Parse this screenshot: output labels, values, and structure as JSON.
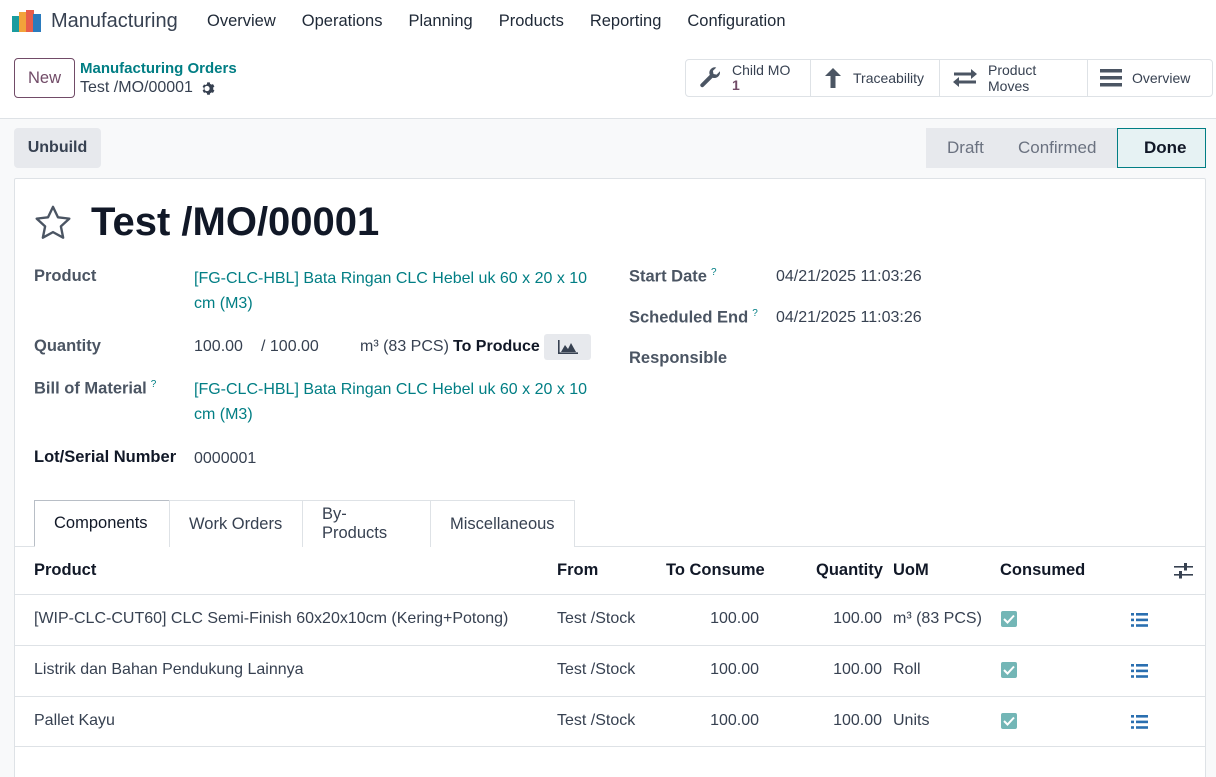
{
  "app": {
    "name": "Manufacturing"
  },
  "menu": [
    "Overview",
    "Operations",
    "Planning",
    "Products",
    "Reporting",
    "Configuration"
  ],
  "control": {
    "new_label": "New",
    "breadcrumb_parent": "Manufacturing Orders",
    "breadcrumb_current": "Test /MO/00001"
  },
  "smart_buttons": {
    "child_mo_label": "Child MO",
    "child_mo_count": "1",
    "traceability": "Traceability",
    "product_moves": "Product Moves",
    "overview": "Overview"
  },
  "actions": {
    "unbuild": "Unbuild"
  },
  "status": {
    "stages": [
      "Draft",
      "Confirmed",
      "Done"
    ],
    "current": "Done"
  },
  "form": {
    "title": "Test /MO/00001",
    "product_label": "Product",
    "product_line1": "[FG-CLC-HBL] Bata Ringan CLC Hebel uk 60 x 20 x 10",
    "product_line2": "cm (M3)",
    "quantity_label": "Quantity",
    "quantity_value": "100.00",
    "quantity_total": "/ 100.00",
    "quantity_uom": "m³ (83 PCS)",
    "to_produce": "To Produce",
    "bom_label": "Bill of Material",
    "bom_line1": "[FG-CLC-HBL] Bata Ringan CLC Hebel uk 60 x 20 x 10",
    "bom_line2": "cm (M3)",
    "lot_label": "Lot/Serial Number",
    "lot_value": "0000001",
    "start_label": "Start Date",
    "start_value": "04/21/2025 11:03:26",
    "end_label": "Scheduled End",
    "end_value": "04/21/2025 11:03:26",
    "responsible_label": "Responsible",
    "help_mark": "?"
  },
  "tabs": [
    "Components",
    "Work Orders",
    "By-Products",
    "Miscellaneous"
  ],
  "table": {
    "headers": {
      "product": "Product",
      "from": "From",
      "to_consume": "To Consume",
      "quantity": "Quantity",
      "uom": "UoM",
      "consumed": "Consumed"
    },
    "rows": [
      {
        "product": "[WIP-CLC-CUT60] CLC Semi-Finish 60x20x10cm (Kering+Potong)",
        "from": "Test /Stock",
        "to_consume": "100.00",
        "quantity": "100.00",
        "uom": "m³ (83 PCS)",
        "consumed": true
      },
      {
        "product": "Listrik dan Bahan Pendukung Lainnya",
        "from": "Test /Stock",
        "to_consume": "100.00",
        "quantity": "100.00",
        "uom": "Roll",
        "consumed": true
      },
      {
        "product": "Pallet Kayu",
        "from": "Test /Stock",
        "to_consume": "100.00",
        "quantity": "100.00",
        "uom": "Units",
        "consumed": true
      }
    ]
  },
  "colors": {
    "brand": "#714b67",
    "link": "#017e84",
    "check": "#73b6b6"
  }
}
